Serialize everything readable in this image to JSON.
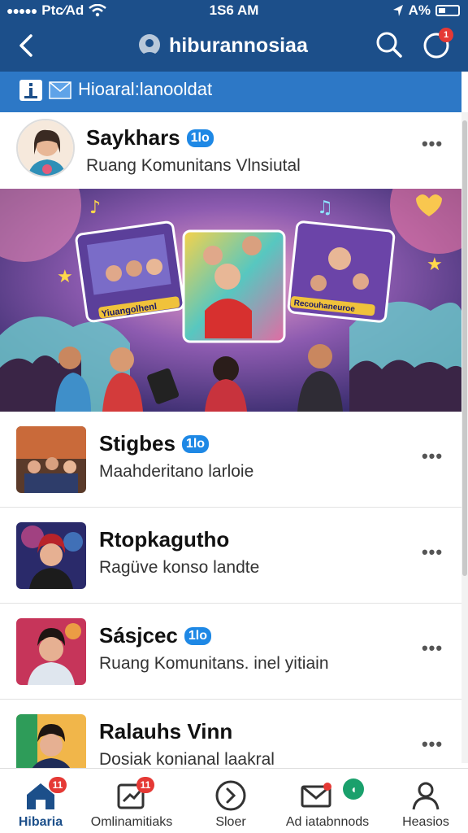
{
  "status_bar": {
    "carrier": "Ptc⁄Ad",
    "time": "1S6 AM",
    "battery_text": "A%"
  },
  "header": {
    "title": "hiburannosiaa"
  },
  "notifications": {
    "badge": "1"
  },
  "sub_banner": {
    "text": "Hioaral:lanooldat"
  },
  "featured": {
    "name": "Saykhars",
    "badge": "1lo",
    "subtitle": "Ruang Komunitans Vlnsiutal",
    "more": "•••"
  },
  "list": [
    {
      "name": "Stigbes",
      "badge": "1lo",
      "subtitle": "Maahderitano larloie",
      "more": "•••"
    },
    {
      "name": "Rtopkagutho",
      "badge": "",
      "subtitle": "Ragüve konso landte",
      "more": "•••"
    },
    {
      "name": "Sásjcec",
      "badge": "1lo",
      "subtitle": "Ruang Komunitans. inel yitiain",
      "more": "•••"
    },
    {
      "name": "Ralauhs Vinn",
      "badge": "",
      "subtitle": "Dosiak konianal laakral",
      "more": "•••"
    }
  ],
  "hero": {
    "left_card_label": "Yiuangolhenl",
    "right_card_label": "Recouhaneuroe"
  },
  "bottom_nav": [
    {
      "label": "Hibaria",
      "icon": "home-icon",
      "badge": "11",
      "active": true
    },
    {
      "label": "Omlinamitiaks",
      "icon": "chart-icon",
      "badge": "11",
      "active": false
    },
    {
      "label": "Sloer",
      "icon": "forward-icon",
      "badge": "",
      "active": false
    },
    {
      "label": "Ad iatabnnods",
      "icon": "mail-icon",
      "badge": "",
      "active": false
    },
    {
      "label": "Heasios",
      "icon": "profile-icon",
      "badge": "",
      "active": false
    }
  ],
  "colors": {
    "primary": "#1c4f8a",
    "accent": "#2d78c6",
    "badge": "#e53935",
    "verify": "#1e88e5"
  }
}
